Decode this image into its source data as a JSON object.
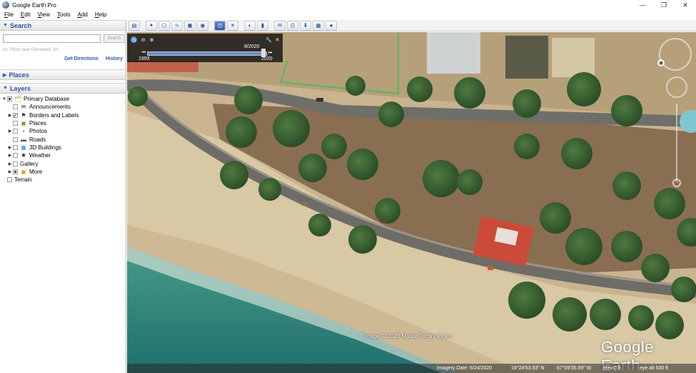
{
  "window": {
    "title": "Google Earth Pro",
    "controls": {
      "minimize": "—",
      "restore": "❐",
      "close": "✕"
    }
  },
  "menu": [
    {
      "accel": "F",
      "rest": "ile"
    },
    {
      "accel": "E",
      "rest": "dit"
    },
    {
      "accel": "V",
      "rest": "iew"
    },
    {
      "accel": "T",
      "rest": "ools"
    },
    {
      "accel": "A",
      "rest": "dd"
    },
    {
      "accel": "H",
      "rest": "elp"
    }
  ],
  "search": {
    "header": "Search",
    "placeholder": "",
    "button": "Search",
    "hint": "ex: Pizza near Cleveland, NY",
    "get_directions": "Get Directions",
    "history": "History"
  },
  "places": {
    "header": "Places"
  },
  "layers": {
    "header": "Layers",
    "items": [
      {
        "label": "Primary Database",
        "expander": "▼",
        "check": "partial",
        "icon": "folder-icon",
        "indent": 0
      },
      {
        "label": "Announcements",
        "expander": "",
        "check": "none",
        "icon": "envelope-icon",
        "indent": 1
      },
      {
        "label": "Borders and Labels",
        "expander": "▶",
        "check": "checked",
        "icon": "flag-icon",
        "indent": 1
      },
      {
        "label": "Places",
        "expander": "",
        "check": "none",
        "icon": "places-icon",
        "indent": 1
      },
      {
        "label": "Photos",
        "expander": "▶",
        "check": "none",
        "icon": "photo-icon",
        "indent": 1
      },
      {
        "label": "Roads",
        "expander": "",
        "check": "none",
        "icon": "road-icon",
        "indent": 1
      },
      {
        "label": "3D Buildings",
        "expander": "▶",
        "check": "none",
        "icon": "building-icon",
        "indent": 1
      },
      {
        "label": "Weather",
        "expander": "▶",
        "check": "none",
        "icon": "sun-icon",
        "indent": 1
      },
      {
        "label": "Gallery",
        "expander": "▶",
        "check": "none",
        "icon": "",
        "indent": 1
      },
      {
        "label": "More",
        "expander": "▶",
        "check": "partial",
        "icon": "more-folder-icon",
        "indent": 1
      },
      {
        "label": "Terrain",
        "expander": "",
        "check": "none",
        "icon": "",
        "indent": 0
      }
    ]
  },
  "toolbar": [
    {
      "name": "sidebar-toggle-button",
      "glyph": "▤",
      "active": false
    },
    {
      "name": "add-placemark-button",
      "glyph": "✦",
      "active": false
    },
    {
      "name": "add-polygon-button",
      "glyph": "⬠",
      "active": false
    },
    {
      "name": "add-path-button",
      "glyph": "∿",
      "active": false
    },
    {
      "name": "add-image-overlay-button",
      "glyph": "▣",
      "active": false
    },
    {
      "name": "record-tour-button",
      "glyph": "◉",
      "active": false
    },
    {
      "name": "historical-imagery-button",
      "glyph": "◷",
      "active": true
    },
    {
      "name": "sunlight-button",
      "glyph": "☀",
      "active": false
    },
    {
      "name": "switch-planet-button",
      "glyph": "◐",
      "active": false
    },
    {
      "name": "ruler-button",
      "glyph": "▮",
      "active": false
    },
    {
      "name": "email-button",
      "glyph": "✉",
      "active": false
    },
    {
      "name": "print-button",
      "glyph": "⎙",
      "active": false
    },
    {
      "name": "save-image-button",
      "glyph": "⬇",
      "active": false
    },
    {
      "name": "view-in-maps-button",
      "glyph": "▦",
      "active": false
    },
    {
      "name": "earth-button",
      "glyph": "●",
      "active": false
    }
  ],
  "time_slider": {
    "start_year": "1993",
    "end_year": "2020",
    "current": "8/2020",
    "position_fraction": 0.97
  },
  "map": {
    "copyright": "Image © 2020 Maxar Technologies",
    "logo": "Google Earth"
  },
  "status": {
    "imagery_date": "Imagery Date: 6/24/2020",
    "lat": "18°24'53.93\" N",
    "lon": "67°09'35.59\" W",
    "elev": "elev   0 ft",
    "eye_alt": "eye alt   530 ft"
  }
}
